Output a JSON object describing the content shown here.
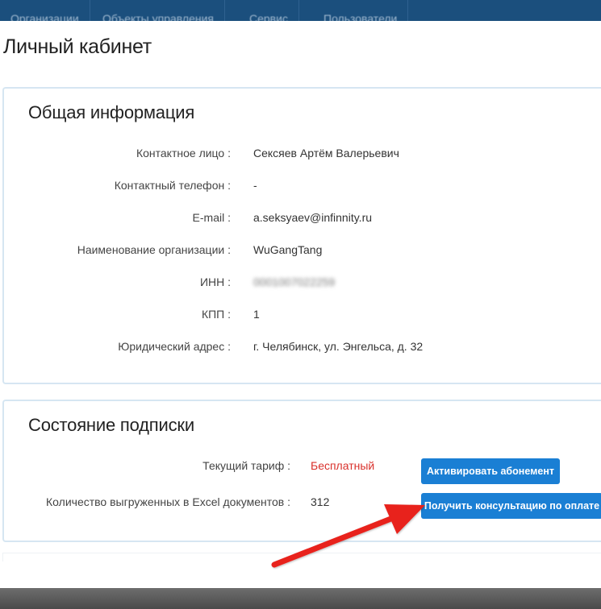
{
  "nav": {
    "items": [
      "Организации",
      "Объекты управления",
      "Сервис",
      "Пользователи"
    ]
  },
  "page": {
    "title": "Личный кабинет"
  },
  "general": {
    "heading": "Общая информация",
    "rows": [
      {
        "label": "Контактное лицо :",
        "value": "Сексяев Артём Валерьевич"
      },
      {
        "label": "Контактный телефон :",
        "value": "-"
      },
      {
        "label": "E-mail :",
        "value": "a.seksyaev@infinnity.ru"
      },
      {
        "label": "Наименование организации :",
        "value": "WuGangTang"
      },
      {
        "label": "ИНН :",
        "value": "0001007022259"
      },
      {
        "label": "КПП :",
        "value": "1"
      },
      {
        "label": "Юридический адрес :",
        "value": "г. Челябинск, ул. Энгельса, д. 32"
      }
    ]
  },
  "subscription": {
    "heading": "Состояние подписки",
    "tariff_label": "Текущий тариф :",
    "tariff_value": "Бесплатный",
    "count_label": "Количество выгруженных в Excel документов :",
    "count_value": "312",
    "activate_button": "Активировать абонемент",
    "consult_button": "Получить консультацию по оплате"
  },
  "colors": {
    "nav_bg": "#1b4f7d",
    "button": "#1a7fd4",
    "tariff_red": "#d9302b",
    "annotation_arrow": "#e8231f"
  }
}
